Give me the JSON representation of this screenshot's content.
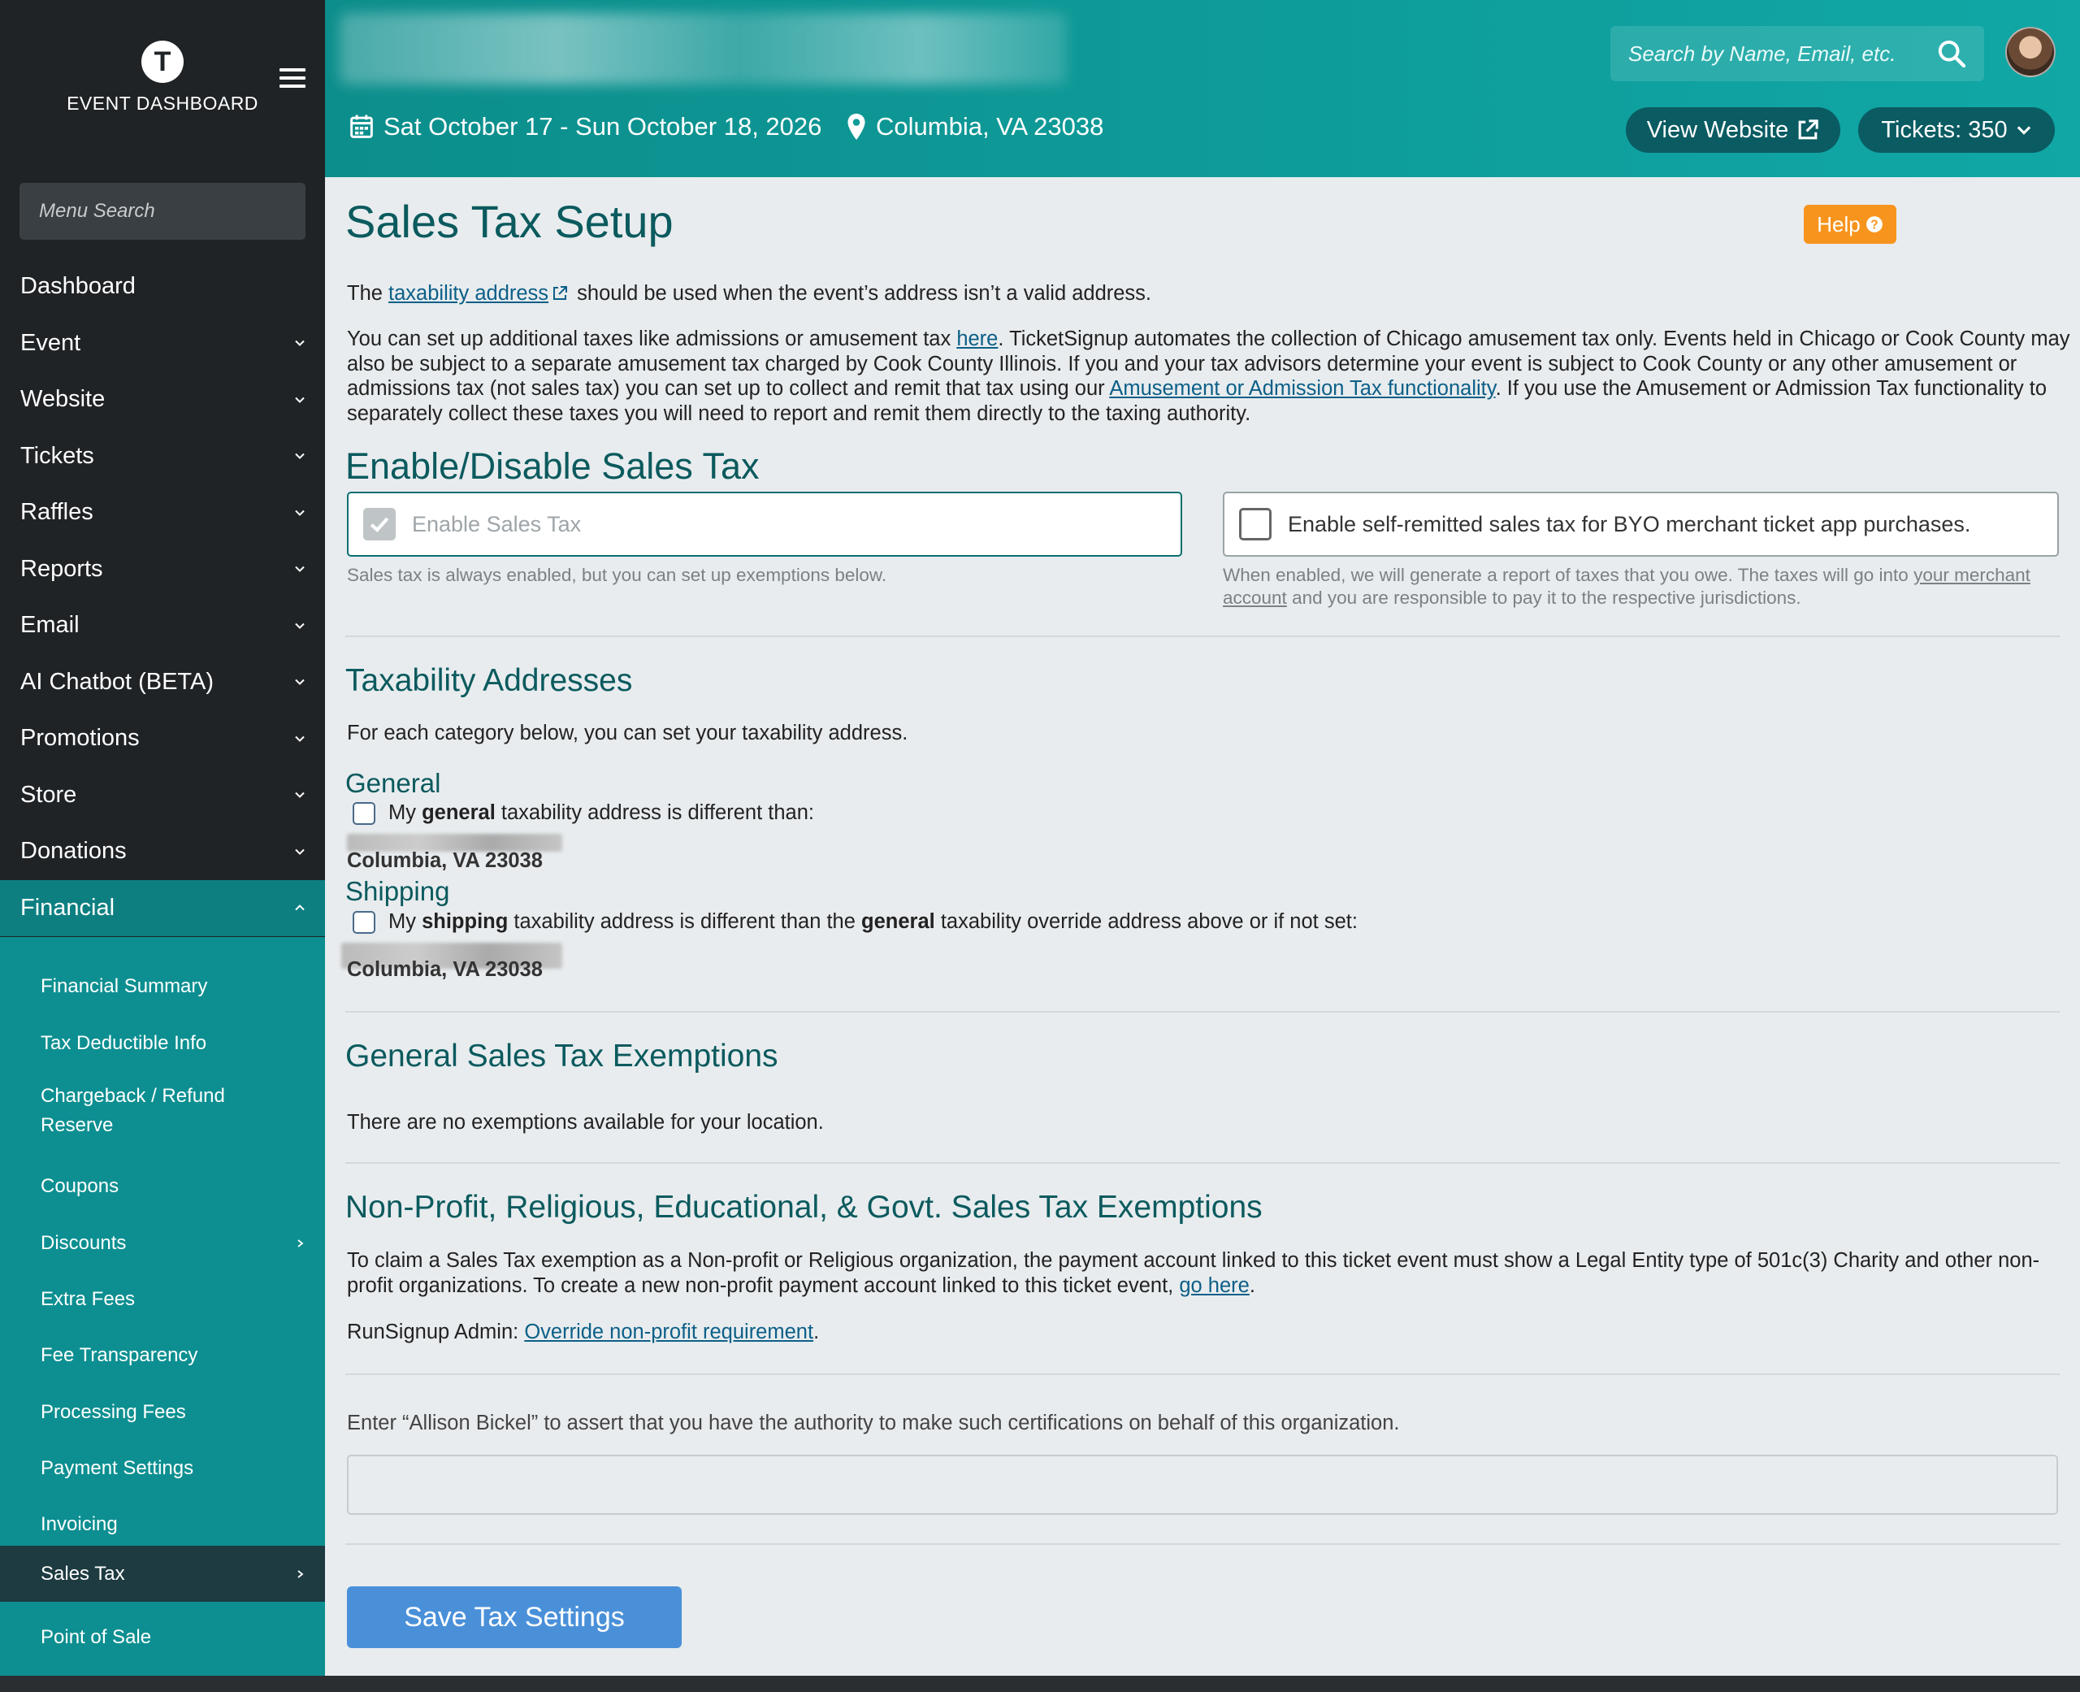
{
  "sidebar": {
    "logo_letter": "T",
    "app_title": "EVENT DASHBOARD",
    "menu_search_placeholder": "Menu Search",
    "items": [
      {
        "label": "Dashboard"
      },
      {
        "label": "Event"
      },
      {
        "label": "Website"
      },
      {
        "label": "Tickets"
      },
      {
        "label": "Raffles"
      },
      {
        "label": "Reports"
      },
      {
        "label": "Email"
      },
      {
        "label": "AI Chatbot (BETA)"
      },
      {
        "label": "Promotions"
      },
      {
        "label": "Store"
      },
      {
        "label": "Donations"
      },
      {
        "label": "Financial"
      }
    ],
    "financial_subitems": [
      {
        "label": "Financial Summary"
      },
      {
        "label": "Tax Deductible Info"
      },
      {
        "label": "Chargeback / Refund"
      },
      {
        "label": "Reserve"
      },
      {
        "label": "Coupons"
      },
      {
        "label": "Discounts"
      },
      {
        "label": "Extra Fees"
      },
      {
        "label": "Fee Transparency"
      },
      {
        "label": "Processing Fees"
      },
      {
        "label": "Payment Settings"
      },
      {
        "label": "Invoicing"
      },
      {
        "label": "Sales Tax"
      },
      {
        "label": "Point of Sale"
      }
    ]
  },
  "header": {
    "date_range": "Sat October 17 - Sun October 18, 2026",
    "location": "Columbia, VA 23038",
    "search_placeholder": "Search by Name, Email, etc.",
    "view_website_label": "View Website",
    "tickets_label": "Tickets: 350"
  },
  "main": {
    "page_title": "Sales Tax Setup",
    "help_label": "Help",
    "intro1": {
      "pre": "The ",
      "link": "taxability address",
      "post": " should be used when the event’s address isn’t a valid address."
    },
    "intro2": {
      "pre": "You can set up additional taxes like admissions or amusement tax ",
      "link1": "here",
      "mid": ". TicketSignup automates the collection of Chicago amusement tax only. Events held in Chicago or Cook County may also be subject to a separate amusement tax charged by Cook County Illinois. If you and your tax advisors determine your event is subject to Cook County or any other amusement or admissions tax (not sales tax) you can set up to collect and remit that tax using our ",
      "link2": "Amusement or Admission Tax functionality",
      "post": ". If you use the Amusement or Admission Tax functionality to separately collect these taxes you will need to report and remit them directly to the taxing authority."
    },
    "enable_heading": "Enable/Disable Sales Tax",
    "enable_sales_tax_label": "Enable Sales Tax",
    "enable_sales_tax_hint": "Sales tax is always enabled, but you can set up exemptions below.",
    "self_remit_label": "Enable self-remitted sales tax for BYO merchant ticket app purchases.",
    "self_remit_hint": {
      "pre": "When enabled, we will generate a report of taxes that you owe. The taxes will go into ",
      "link": "your merchant account",
      "post": " and you are responsible to pay it to the respective jurisdictions."
    },
    "taxability_heading": "Taxability Addresses",
    "taxability_desc": "For each category below, you can set your taxability address.",
    "general_heading": "General",
    "general_chk": {
      "pre": "My ",
      "bold": "general",
      "post": " taxability address is different than:"
    },
    "general_address": "Columbia, VA 23038",
    "shipping_heading": "Shipping",
    "shipping_chk": {
      "pre": "My ",
      "bold1": "shipping",
      "mid": " taxability address is different than the ",
      "bold2": "general",
      "post": " taxability override address above or if not set:"
    },
    "shipping_address": "Columbia, VA 23038",
    "gen_exemptions_heading": "General Sales Tax Exemptions",
    "gen_exemptions_text": "There are no exemptions available for your location.",
    "np_heading": "Non-Profit, Religious, Educational, & Govt. Sales Tax Exemptions",
    "np_text": {
      "pre": "To claim a Sales Tax exemption as a Non-profit or Religious organization, the payment account linked to this ticket event must show a Legal Entity type of 501c(3) Charity and other non-profit organizations. To create a new non-profit payment account linked to this ticket event, ",
      "link": "go here",
      "post": "."
    },
    "admin": {
      "pre": "RunSignup Admin: ",
      "link": "Override non-profit requirement",
      "post": "."
    },
    "assert_text": "Enter “Allison Bickel” to assert that you have the authority to make such certifications on behalf of this organization.",
    "assert_value": "",
    "save_label": "Save Tax Settings"
  },
  "colors": {
    "sidebar_bg": "#1f2326",
    "sidebar_sub_bg": "#0d8f91",
    "header_teal": "#10a7a5",
    "heading_teal": "#0b5a5e",
    "help_orange": "#f7941d",
    "save_blue": "#4a90d9"
  },
  "icons": [
    "hamburger-icon",
    "search-icon",
    "calendar-icon",
    "map-pin-icon",
    "external-link-icon",
    "chevron-down-icon",
    "chevron-up-icon",
    "chevron-right-icon",
    "question-circle-icon",
    "check-icon",
    "avatar"
  ]
}
